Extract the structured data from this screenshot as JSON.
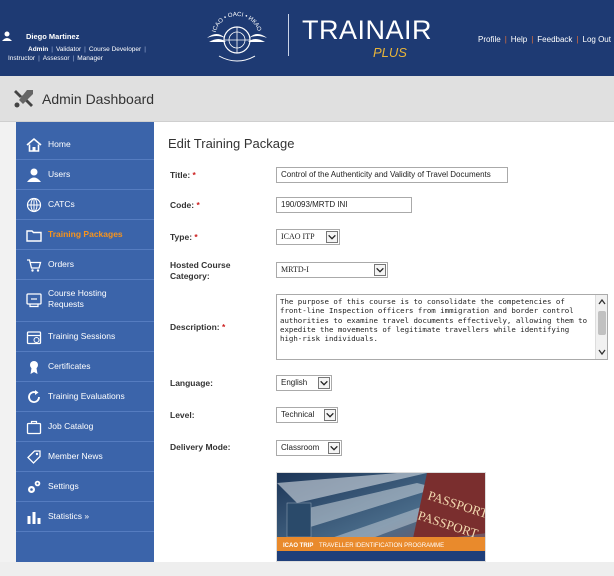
{
  "header": {
    "user_name": "Diego Martinez",
    "roles": [
      "Admin",
      "Validator",
      "Course Developer",
      "Instructor",
      "Assessor",
      "Manager"
    ],
    "logo_text": "TRAINAIR",
    "logo_sub": "PLUS",
    "emblem_text": "ICAO • OACI • ИКАО",
    "nav": [
      "Profile",
      "Help",
      "Feedback",
      "Log Out"
    ]
  },
  "admin_bar": {
    "title": "Admin Dashboard"
  },
  "sidebar": {
    "items": [
      {
        "label": "Home",
        "icon": "home-icon"
      },
      {
        "label": "Users",
        "icon": "user-icon"
      },
      {
        "label": "CATCs",
        "icon": "globe-icon"
      },
      {
        "label": "Training Packages",
        "icon": "folder-icon"
      },
      {
        "label": "Orders",
        "icon": "cart-icon"
      },
      {
        "label": "Course Hosting Requests",
        "icon": "hosting-icon"
      },
      {
        "label": "Training Sessions",
        "icon": "calendar-icon"
      },
      {
        "label": "Certificates",
        "icon": "ribbon-icon"
      },
      {
        "label": "Training Evaluations",
        "icon": "refresh-icon"
      },
      {
        "label": "Job Catalog",
        "icon": "briefcase-icon"
      },
      {
        "label": "Member News",
        "icon": "tag-icon"
      },
      {
        "label": "Settings",
        "icon": "gear-icon"
      },
      {
        "label": "Statistics »",
        "icon": "bar-chart-icon"
      }
    ],
    "active": "Training Packages"
  },
  "form": {
    "heading": "Edit Training Package",
    "title_label": "Title:",
    "title_value": "Control of the Authenticity and Validity of Travel Documents",
    "code_label": "Code:",
    "code_value": "190/093/MRTD INI",
    "type_label": "Type:",
    "type_value": "ICAO ITP",
    "hosted_label": "Hosted Course Category:",
    "hosted_value": "MRTD-I",
    "description_label": "Description:",
    "description_value": "The purpose of this course is to consolidate the competencies of front-line Inspection officers from immigration and border control authorities to examine travel documents effectively, allowing them to expedite the movements of legitimate travellers while identifying high-risk individuals.",
    "language_label": "Language:",
    "language_value": "English",
    "level_label": "Level:",
    "level_value": "Technical",
    "delivery_label": "Delivery Mode:",
    "delivery_value": "Classroom",
    "required_mark": "*"
  },
  "image_banner": {
    "tag1": "ICAO TRIP",
    "tag2": "TRAVELLER IDENTIFICATION PROGRAMME",
    "passport_word": "PASSPORT"
  },
  "colors": {
    "header": "#1e3a73",
    "sidebar": "#3b64aa",
    "active": "#f7941d",
    "required": "#cc1f1f",
    "logo_sub": "#e8b43a"
  }
}
